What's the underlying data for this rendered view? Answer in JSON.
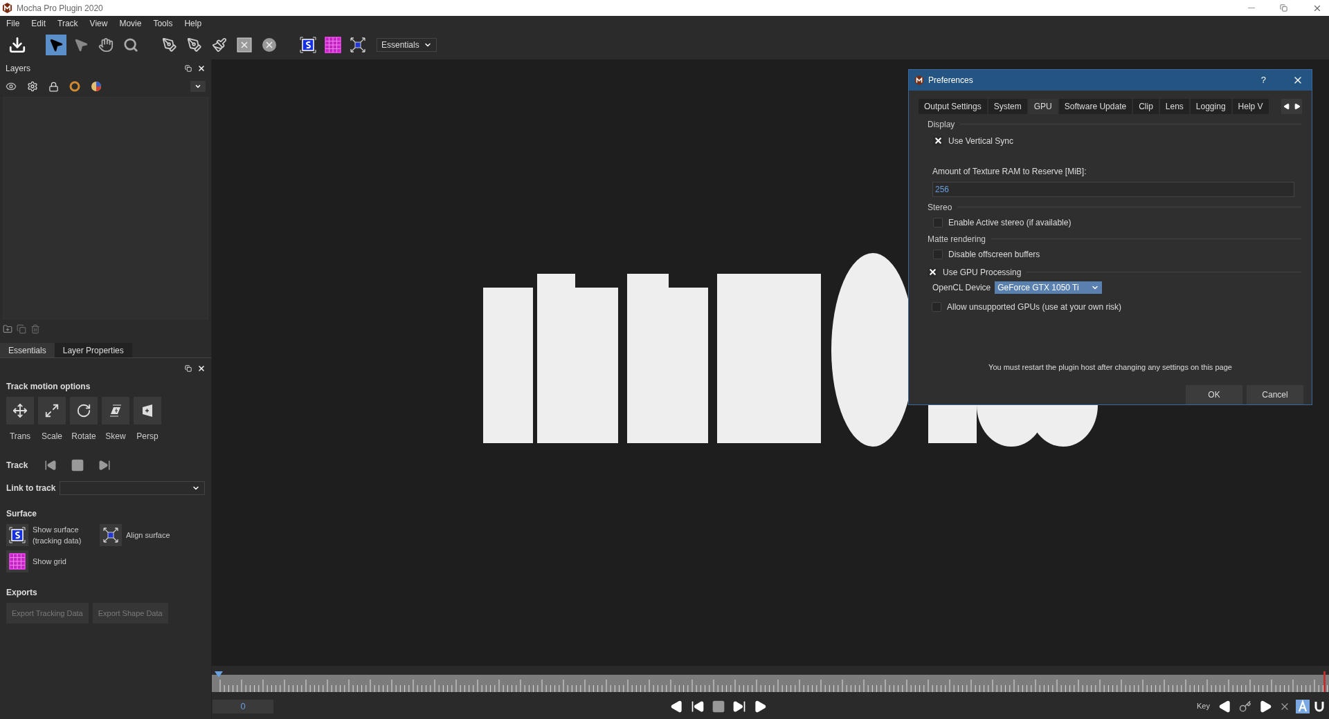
{
  "window": {
    "title": "Mocha Pro Plugin 2020"
  },
  "menu": [
    "File",
    "Edit",
    "Track",
    "View",
    "Movie",
    "Tools",
    "Help"
  ],
  "toolbar": {
    "tools": [
      {
        "kind": "download",
        "selected": false
      },
      {
        "kind": "pointer",
        "selected": true
      },
      {
        "kind": "add-pointer",
        "selected": false
      },
      {
        "kind": "hand",
        "selected": false
      },
      {
        "kind": "zoom",
        "selected": false
      },
      {
        "kind": "pen",
        "selected": false
      },
      {
        "kind": "magnet-pen",
        "selected": false
      },
      {
        "kind": "brush",
        "selected": false
      },
      {
        "kind": "rect-x",
        "selected": false
      },
      {
        "kind": "circle-x",
        "selected": false
      },
      {
        "kind": "surface",
        "selected": false
      },
      {
        "kind": "grid",
        "selected": false
      },
      {
        "kind": "align",
        "selected": false
      }
    ],
    "workspace": "Essentials"
  },
  "layers_panel": {
    "title": "Layers"
  },
  "panel_tabs": [
    {
      "label": "Essentials",
      "selected": true
    },
    {
      "label": "Layer Properties",
      "selected": false
    }
  ],
  "essentials": {
    "track_motion_title": "Track motion options",
    "motion_options": [
      {
        "kind": "trans",
        "label": "Trans"
      },
      {
        "kind": "scale",
        "label": "Scale"
      },
      {
        "kind": "rotate",
        "label": "Rotate"
      },
      {
        "kind": "skew",
        "label": "Skew"
      },
      {
        "kind": "persp",
        "label": "Persp"
      }
    ],
    "track_label": "Track",
    "link_label": "Link to track",
    "surface_title": "Surface",
    "surface_items": [
      {
        "kind": "surface",
        "label": "Show surface\n(tracking data)"
      },
      {
        "kind": "align",
        "label": "Align surface"
      },
      {
        "kind": "grid",
        "label": "Show grid"
      }
    ],
    "exports_title": "Exports",
    "export_buttons": [
      {
        "label": "Export Tracking Data",
        "disabled": true
      },
      {
        "label": "Export Shape Data",
        "disabled": true
      }
    ]
  },
  "timeline": {
    "frame": "0",
    "key_label": "Key"
  },
  "dialog": {
    "title": "Preferences",
    "help": "?",
    "tabs": [
      {
        "label": "Output Settings",
        "selected": false
      },
      {
        "label": "System",
        "selected": false
      },
      {
        "label": "GPU",
        "selected": true
      },
      {
        "label": "Software Update",
        "selected": false
      },
      {
        "label": "Clip",
        "selected": false
      },
      {
        "label": "Lens",
        "selected": false
      },
      {
        "label": "Logging",
        "selected": false
      },
      {
        "label": "Help V",
        "selected": false
      }
    ],
    "display_title": "Display",
    "vsync": {
      "label": "Use Vertical Sync",
      "checked": true
    },
    "texture_label": "Amount of Texture RAM to Reserve [MiB]:",
    "texture_value": "256",
    "stereo_title": "Stereo",
    "stereo": {
      "label": "Enable Active stereo (if available)",
      "checked": false
    },
    "matte_title": "Matte rendering",
    "offscreen": {
      "label": "Disable offscreen buffers",
      "checked": false
    },
    "gpu_processing": {
      "label": "Use GPU Processing",
      "checked": true
    },
    "opencl_label": "OpenCL Device",
    "opencl_value": "GeForce GTX 1050 Ti",
    "unsupported": {
      "label": "Allow unsupported GPUs (use at your own risk)",
      "checked": false
    },
    "note": "You must restart the plugin host after changing any settings on this page",
    "buttons": [
      "OK",
      "Cancel"
    ]
  }
}
